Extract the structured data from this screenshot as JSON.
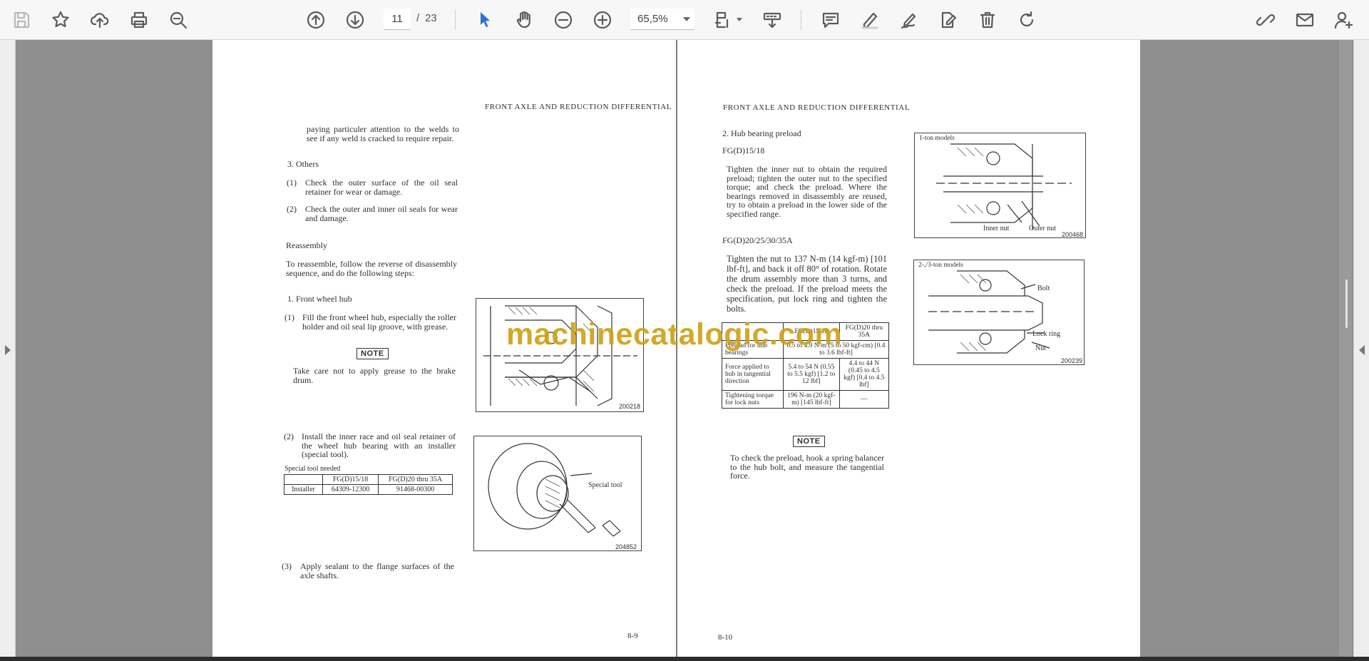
{
  "toolbar": {
    "current_page": "11",
    "page_separator": "/",
    "total_pages": "23",
    "zoom": "65,5%",
    "left_tools": [
      "save-icon",
      "bookmark-star-icon",
      "upload-cloud-icon",
      "print-icon",
      "zoom-search-icon"
    ],
    "nav_tools": [
      "page-up-icon",
      "page-down-icon"
    ],
    "right_tools": [
      "comment-icon",
      "highlight-pen-icon",
      "sign-pen-icon",
      "edit-document-icon",
      "trash-icon",
      "redo-icon",
      "share-link-icon",
      "email-icon",
      "add-user-icon"
    ]
  },
  "watermark": "machinecatalogic.com",
  "left_page": {
    "header": "FRONT AXLE AND REDUCTION DIFFERENTIAL",
    "intro": "paying particuler attention to the welds to see if any weld is cracked to require repair.",
    "others_title": "3.  Others",
    "others_1_num": "(1)",
    "others_1": "Check the outer surface of the oil seal retainer for wear or damage.",
    "others_2_num": "(2)",
    "others_2": "Check the outer and inner oil seals for wear and damage.",
    "reassembly_title": "Reassembly",
    "reassembly_text": "To reassemble, follow the reverse of disassembly sequence, and do the following steps:",
    "step1_title": "1.  Front wheel hub",
    "step1_1_num": "(1)",
    "step1_1": "Fill the front wheel hub, especially the roller holder and oil seal lip groove, with grease.",
    "note_label": "NOTE",
    "note_text": "Take care not to apply grease to the brake drum.",
    "step1_2_num": "(2)",
    "step1_2": "Install the inner race and oil seal retainer of the wheel hub bearing with an installer (special tool).",
    "tool_caption": "Special tool needed",
    "tool_table": {
      "headers": [
        "",
        "FG(D)15/18",
        "FG(D)20 thru 35A"
      ],
      "row": [
        "Installer",
        "64309-12300",
        "91468-00300"
      ]
    },
    "step1_3_num": "(3)",
    "step1_3": "Apply sealant to the flange surfaces of the axle shafts.",
    "fig1_num": "200218",
    "fig2_label": "Special tool",
    "fig2_num": "204852",
    "page_number": "8-9"
  },
  "right_page": {
    "header": "FRONT AXLE AND REDUCTION DIFFERENTIAL",
    "section_title": "2.  Hub bearing preload",
    "model_1": "FG(D)15/18",
    "text_1": "Tighten the inner nut to obtain the required preload; tighten the outer nut to the specified torque; and check the preload. Where the bearings removed in disassembly are reused, try to obtain a preload in the lower side of the specified range.",
    "model_2": "FG(D)20/25/30/35A",
    "text_2": "Tighten the nut to 137 N-m (14 kgf-m) [101 lbf-ft], and back it off 80° of rotation. Rotate the drum assembly more than 3 turns, and check the preload. If the preload meets the specification, put lock ring and tighten the bolts.",
    "spec_table": {
      "headers": [
        "",
        "FG(D)15/18",
        "FG(D)20 thru 35A"
      ],
      "row1_label": "Preload for hub bearings",
      "row1_value": "0.5 to 4.9 N-m (5 to 50 kgf-cm) [0.4 to 3.6 lbf-ft]",
      "row2_label": "Force applied to hub in tangential direction",
      "row2_a": "5.4 to 54 N (0.55 to 5.5 kgf) [1.2 to 12 lbf]",
      "row2_b": "4.4 to 44 N (0.45 to 4.5 kgf) [0.4 to 4.5 lbf]",
      "row3_label": "Tightening torque for lock nuts",
      "row3_a": "196 N-m (20 kgf-m) [145 lbf-ft]",
      "row3_b": "—"
    },
    "note_label": "NOTE",
    "note_text": "To check the preload, hook a spring balancer to the hub bolt, and measure the tangential force.",
    "fig1_title": "1-ton models",
    "fig1_inner": "Inner nut",
    "fig1_outer": "Outer nut",
    "fig1_num": "200468",
    "fig2_title": "2-,/3-ton models",
    "fig2_bolt": "Bolt",
    "fig2_lockring": "Lock ring",
    "fig2_nut": "Nut",
    "fig2_num": "200239",
    "page_number": "8-10"
  }
}
